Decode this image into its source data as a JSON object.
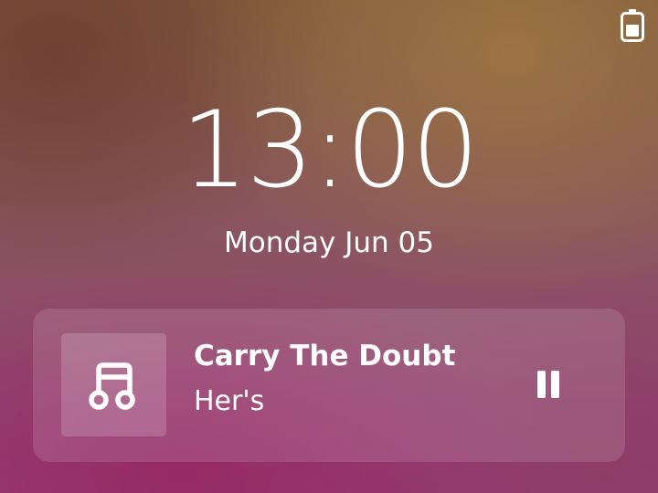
{
  "status_bar": {
    "battery_icon": "battery-icon"
  },
  "lock_screen": {
    "time": "13:00",
    "date": "Monday Jun 05"
  },
  "media_player": {
    "album_art_icon": "music-note-icon",
    "title": "Carry The Doubt",
    "artist": "Her's",
    "playback_state": "playing",
    "control_icon": "pause-icon"
  }
}
